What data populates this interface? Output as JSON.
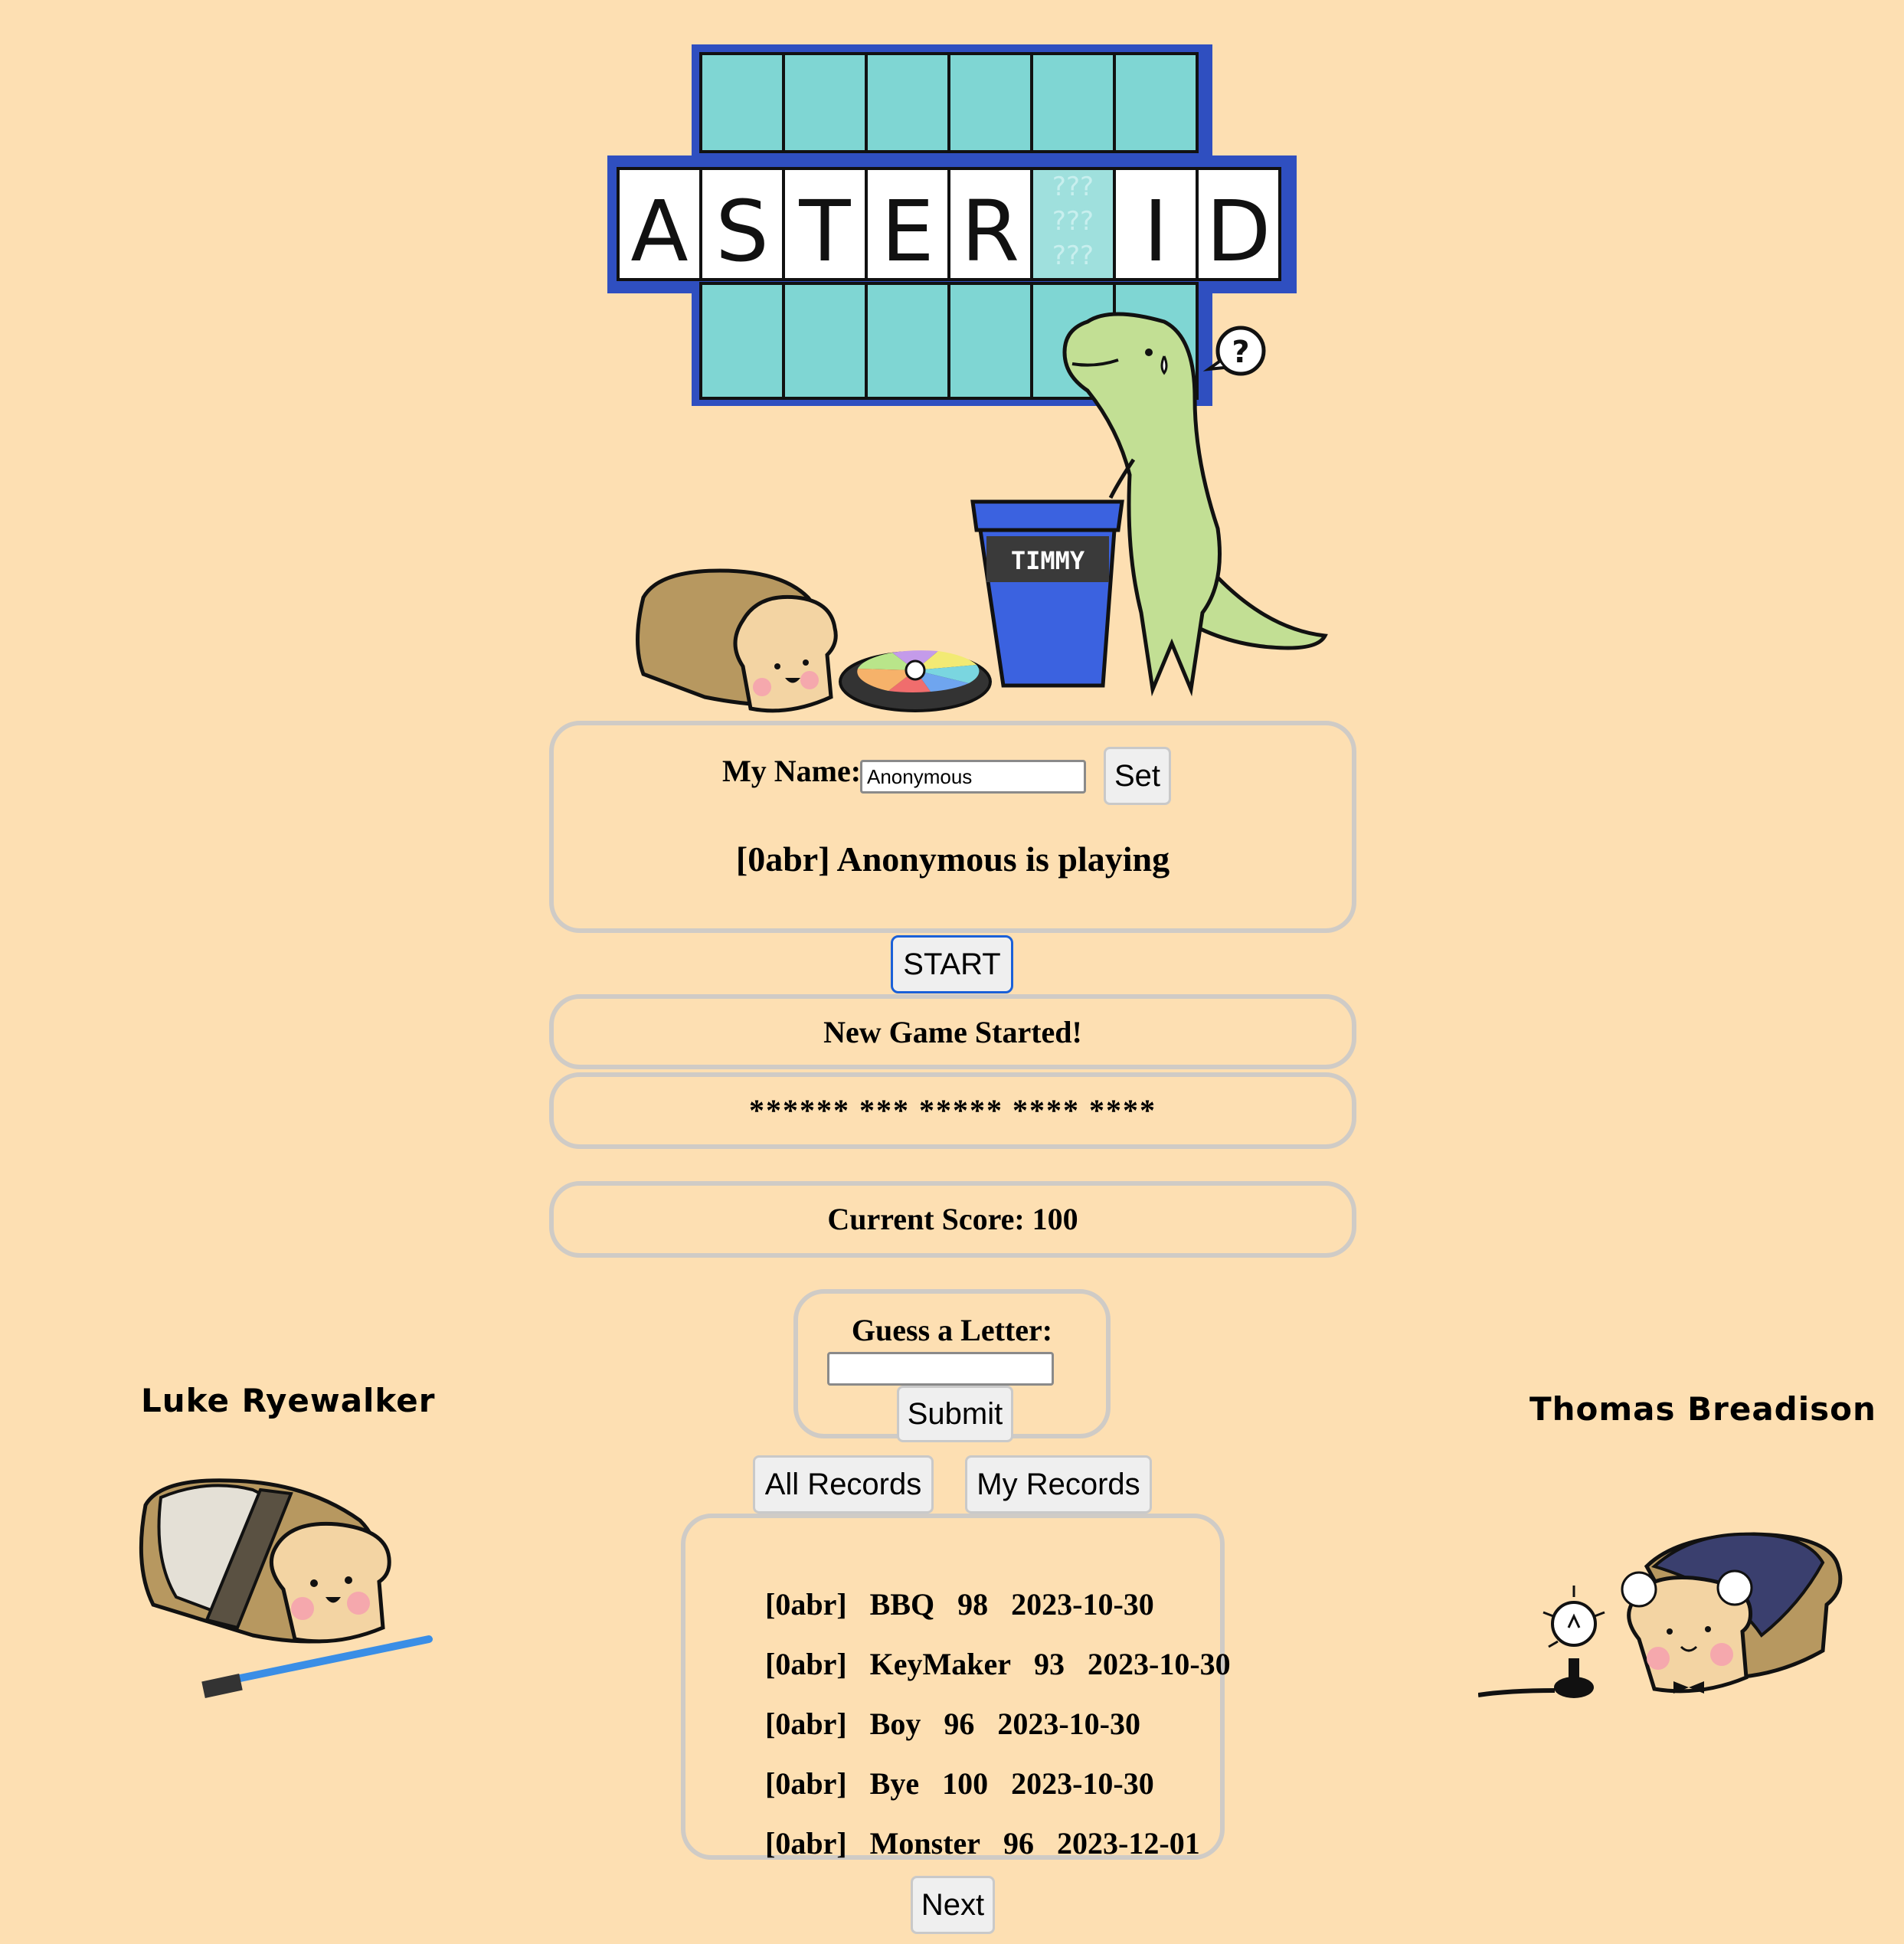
{
  "logo": {
    "letters": [
      "A",
      "S",
      "T",
      "E",
      "R",
      "",
      "I",
      "D"
    ],
    "mystery_mark": "???"
  },
  "scene": {
    "cup_label": "TIMMY",
    "speech_bubble": "?"
  },
  "name_panel": {
    "label": "My Name:",
    "input_value": "Anonymous",
    "set_button": "Set",
    "status": "[0abr] Anonymous is playing"
  },
  "start_button": "START",
  "message": "New Game Started!",
  "puzzle": "****** *** ***** **** ****",
  "score": "Current Score: 100",
  "guess": {
    "label": "Guess a Letter:",
    "input_value": "",
    "submit_button": "Submit"
  },
  "records_tabs": {
    "all": "All Records",
    "mine": "My Records"
  },
  "records": [
    {
      "id": "[0abr]",
      "name": "BBQ",
      "score": "98",
      "date": "2023-10-30"
    },
    {
      "id": "[0abr]",
      "name": "KeyMaker",
      "score": "93",
      "date": "2023-10-30"
    },
    {
      "id": "[0abr]",
      "name": "Boy",
      "score": "96",
      "date": "2023-10-30"
    },
    {
      "id": "[0abr]",
      "name": "Bye",
      "score": "100",
      "date": "2023-10-30"
    },
    {
      "id": "[0abr]",
      "name": "Monster",
      "score": "96",
      "date": "2023-12-01"
    }
  ],
  "next_button": "Next",
  "characters": {
    "left_name": "Luke Ryewalker",
    "right_name": "Thomas Breadison"
  },
  "colors": {
    "background": "#fddfb2",
    "board_teal": "#7fd6d3",
    "board_border": "#2f4fc0",
    "dino_green": "#c2df94",
    "cup_blue": "#3b62e0"
  }
}
